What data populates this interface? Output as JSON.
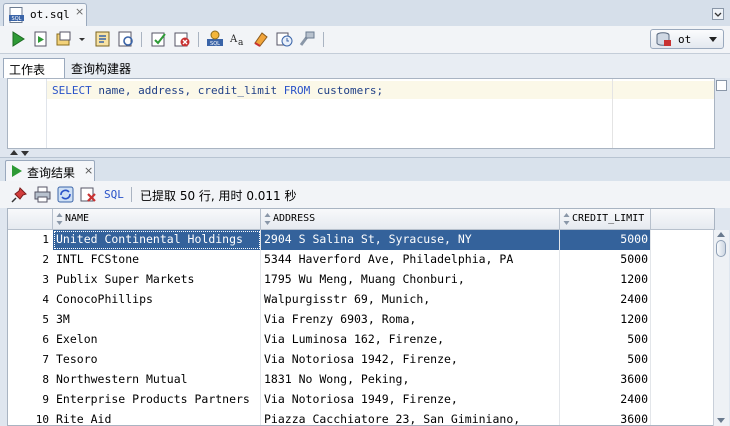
{
  "file_tab": {
    "title": "ot.sql",
    "close": "×"
  },
  "toolbar": {
    "icons": [
      "run-statement-icon",
      "run-script-icon",
      "autotrace-icon",
      "dropdown-arrow-icon",
      "explain-plan-icon",
      "sql-tuning-icon",
      "commit-icon",
      "rollback-icon",
      "unshared-worksheet-icon",
      "to-upper-lower-icon",
      "clear-icon",
      "sql-history-icon",
      "format-icon"
    ],
    "connection": "ot"
  },
  "editor_tabs": {
    "worksheet": "工作表",
    "query_builder": "查询构建器"
  },
  "editor": {
    "sql_parts": [
      {
        "text": "SELECT ",
        "cls": "kw"
      },
      {
        "text": "name, address, credit_limit ",
        "cls": "id"
      },
      {
        "text": "FROM ",
        "cls": "kw"
      },
      {
        "text": "customers;",
        "cls": "id"
      }
    ]
  },
  "results": {
    "tab_title": "查询结果",
    "tab_close": "×",
    "sql_label": "SQL",
    "fetch_info": "已提取 50 行, 用时 0.011 秒",
    "columns": [
      "NAME",
      "ADDRESS",
      "CREDIT_LIMIT"
    ],
    "rows": [
      {
        "n": "1",
        "name": "United Continental Holdings",
        "address": "2904 S Salina St, Syracuse, NY",
        "limit": "5000"
      },
      {
        "n": "2",
        "name": "INTL FCStone",
        "address": "5344 Haverford Ave, Philadelphia, PA",
        "limit": "5000"
      },
      {
        "n": "3",
        "name": "Publix Super Markets",
        "address": "1795 Wu Meng, Muang Chonburi,",
        "limit": "1200"
      },
      {
        "n": "4",
        "name": "ConocoPhillips",
        "address": "Walpurgisstr 69, Munich,",
        "limit": "2400"
      },
      {
        "n": "5",
        "name": "3M",
        "address": "Via Frenzy 6903, Roma,",
        "limit": "1200"
      },
      {
        "n": "6",
        "name": "Exelon",
        "address": "Via Luminosa 162, Firenze,",
        "limit": "500"
      },
      {
        "n": "7",
        "name": "Tesoro",
        "address": "Via Notoriosa 1942, Firenze,",
        "limit": "500"
      },
      {
        "n": "8",
        "name": "Northwestern Mutual",
        "address": "1831 No Wong, Peking,",
        "limit": "3600"
      },
      {
        "n": "9",
        "name": "Enterprise Products Partners",
        "address": "Via Notoriosa 1949, Firenze,",
        "limit": "2400"
      },
      {
        "n": "10",
        "name": "Rite Aid",
        "address": "Piazza Cacchiatore 23, San Giminiano,",
        "limit": "3600"
      }
    ],
    "selected_row": 0
  }
}
